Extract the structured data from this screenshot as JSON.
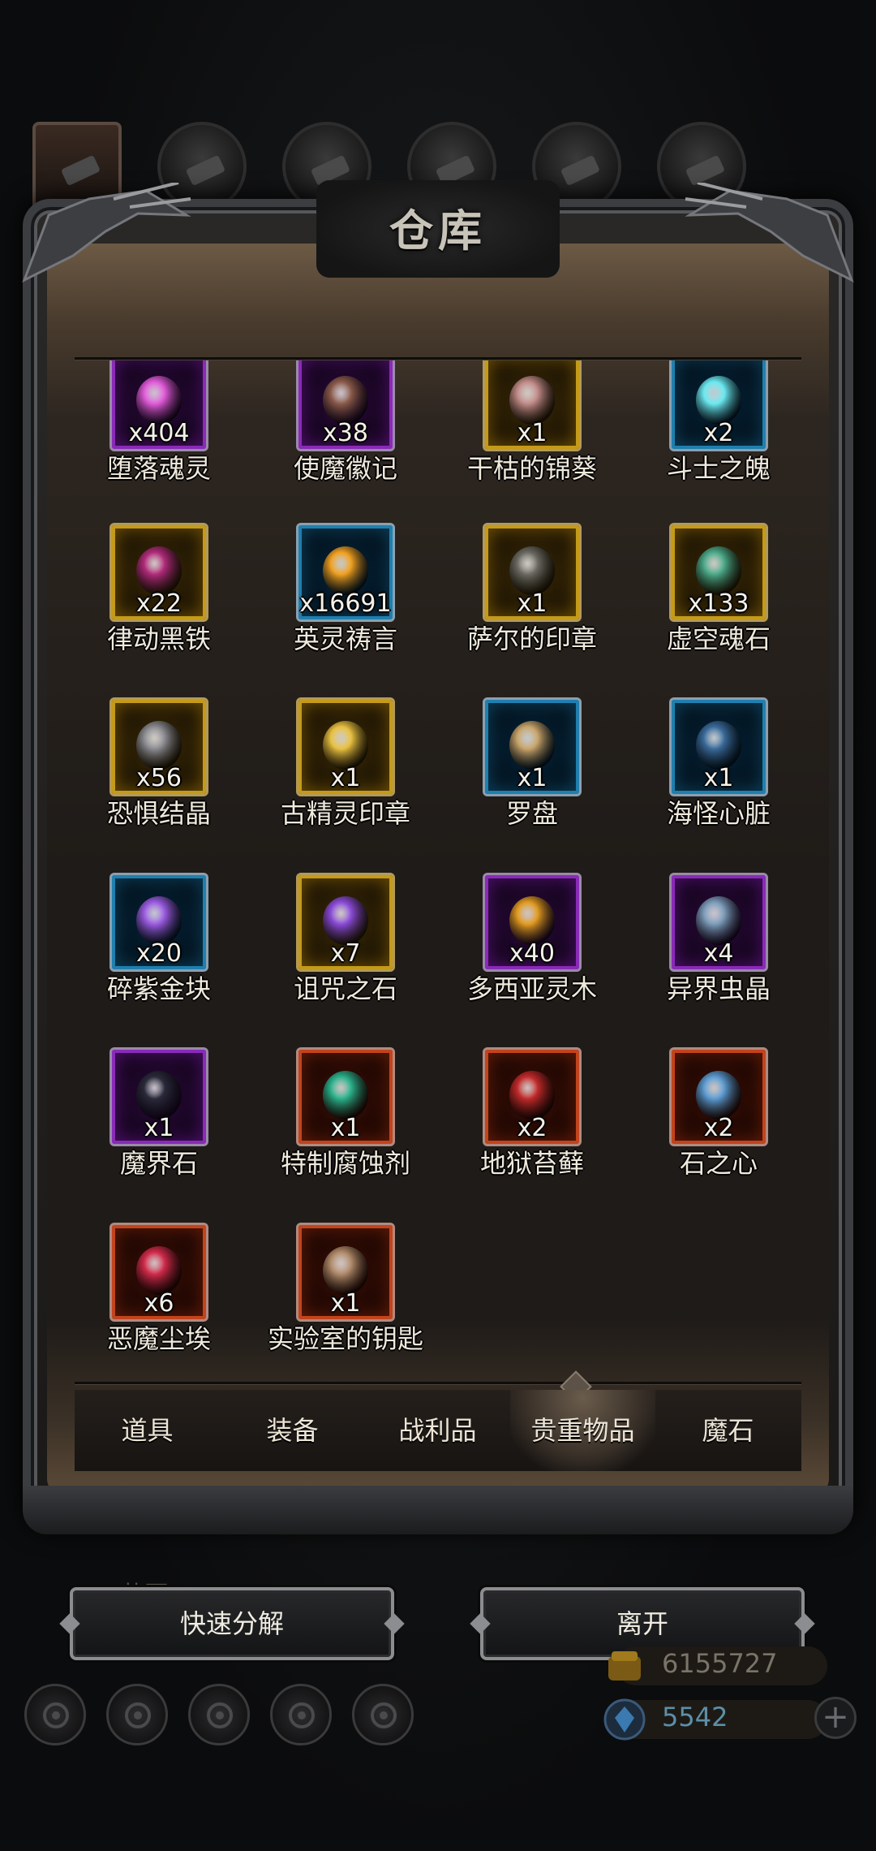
{
  "title": "仓库",
  "top_tabs": [
    {
      "icon": "character-portrait-icon"
    },
    {
      "icon": "orb-icon"
    },
    {
      "icon": "wood-icon"
    },
    {
      "icon": "dark-crystal-icon"
    },
    {
      "icon": "blue-feather-icon"
    },
    {
      "icon": "grey-crystal-icon"
    }
  ],
  "items": [
    {
      "name": "堕落魂灵",
      "qty": "x404",
      "rarity": "purple",
      "icon": "pink-orb-icon",
      "color": "#e05ad8"
    },
    {
      "name": "使魔徽记",
      "qty": "x38",
      "rarity": "purple",
      "icon": "familiar-emblem-icon",
      "color": "#8a5a4a"
    },
    {
      "name": "干枯的锦葵",
      "qty": "x1",
      "rarity": "gold",
      "icon": "withered-mallow-icon",
      "color": "#c08a88"
    },
    {
      "name": "斗士之魄",
      "qty": "x2",
      "rarity": "blue",
      "icon": "cyan-orb-icon",
      "color": "#6ae8f0"
    },
    {
      "name": "律动黑铁",
      "qty": "x22",
      "rarity": "gold",
      "icon": "black-iron-ingot-icon",
      "color": "#b02a7a"
    },
    {
      "name": "英灵祷言",
      "qty": "x16691",
      "rarity": "blue",
      "icon": "golden-sphere-icon",
      "color": "#f0a020"
    },
    {
      "name": "萨尔的印章",
      "qty": "x1",
      "rarity": "gold",
      "icon": "seal-tablet-icon",
      "color": "#6a6a62"
    },
    {
      "name": "虚空魂石",
      "qty": "x133",
      "rarity": "gold",
      "icon": "void-soulstone-icon",
      "color": "#4aa888"
    },
    {
      "name": "恐惧结晶",
      "qty": "x56",
      "rarity": "gold",
      "icon": "fear-crystal-icon",
      "color": "#8a8a90"
    },
    {
      "name": "古精灵印章",
      "qty": "x1",
      "rarity": "gold",
      "icon": "elven-seal-icon",
      "color": "#e8c040"
    },
    {
      "name": "罗盘",
      "qty": "x1",
      "rarity": "blue",
      "icon": "compass-icon",
      "color": "#c8a46a"
    },
    {
      "name": "海怪心脏",
      "qty": "x1",
      "rarity": "blue",
      "icon": "sea-monster-heart-icon",
      "color": "#3a6a9a"
    },
    {
      "name": "碎紫金块",
      "qty": "x20",
      "rarity": "blue",
      "icon": "purple-gold-shard-icon",
      "color": "#9a5ae0"
    },
    {
      "name": "诅咒之石",
      "qty": "x7",
      "rarity": "gold",
      "icon": "cursed-stone-icon",
      "color": "#8a4ad8"
    },
    {
      "name": "多西亚灵木",
      "qty": "x40",
      "rarity": "purple",
      "icon": "spirit-wood-icon",
      "color": "#e09a20"
    },
    {
      "name": "异界虫晶",
      "qty": "x4",
      "rarity": "purple",
      "icon": "otherworld-crystal-icon",
      "color": "#7a9ab8"
    },
    {
      "name": "魔界石",
      "qty": "x1",
      "rarity": "purple",
      "icon": "demon-realm-stone-icon",
      "color": "#2a2a3a"
    },
    {
      "name": "特制腐蚀剂",
      "qty": "x1",
      "rarity": "red",
      "icon": "corrosive-flask-icon",
      "color": "#2ab08a"
    },
    {
      "name": "地狱苔藓",
      "qty": "x2",
      "rarity": "red",
      "icon": "hell-moss-icon",
      "color": "#c02a2a"
    },
    {
      "name": "石之心",
      "qty": "x2",
      "rarity": "red",
      "icon": "stone-heart-icon",
      "color": "#5a9ad0"
    },
    {
      "name": "恶魔尘埃",
      "qty": "x6",
      "rarity": "red",
      "icon": "demon-dust-icon",
      "color": "#d02a4a"
    },
    {
      "name": "实验室的钥匙",
      "qty": "x1",
      "rarity": "red",
      "icon": "key-icon",
      "color": "#b08a6a"
    }
  ],
  "category_tabs": [
    {
      "label": "道具",
      "active": false
    },
    {
      "label": "装备",
      "active": false
    },
    {
      "label": "战利品",
      "active": false
    },
    {
      "label": "贵重物品",
      "active": true
    },
    {
      "label": "魔石",
      "active": false
    }
  ],
  "buttons": {
    "quick_decompose": "快速分解",
    "leave": "离开"
  },
  "background_label": "草园",
  "resources": {
    "gold": "6155727",
    "gems": "5542"
  },
  "bottom_icons": [
    "gear-icon",
    "medal-icon",
    "rune-icon",
    "mail-icon",
    "cube-icon"
  ]
}
